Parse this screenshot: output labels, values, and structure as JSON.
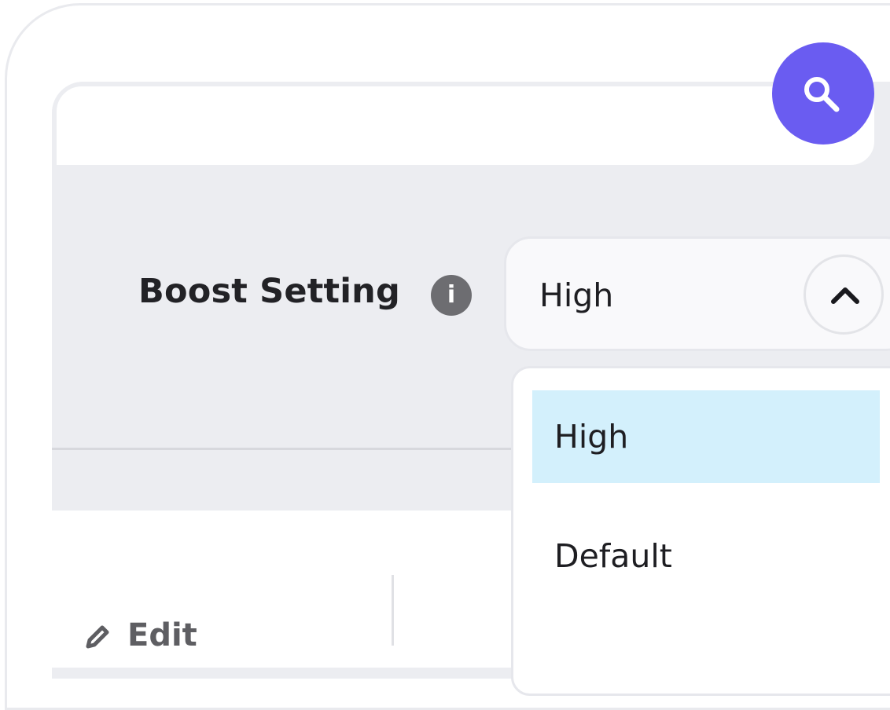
{
  "header": {
    "search_button_icon": "search-icon",
    "accent_color": "#6a5cf1"
  },
  "boost": {
    "label": "Boost Setting",
    "info_icon": "info-icon",
    "info_glyph": "i",
    "selected_value": "High",
    "toggle_icon": "chevron-up-icon"
  },
  "dropdown": {
    "options": [
      {
        "label": "High",
        "selected": true
      },
      {
        "label": "Default",
        "selected": false
      }
    ],
    "highlight_color": "#d3f0fc"
  },
  "table": {
    "edit_label": "Edit",
    "edit_icon": "pencil-icon"
  }
}
